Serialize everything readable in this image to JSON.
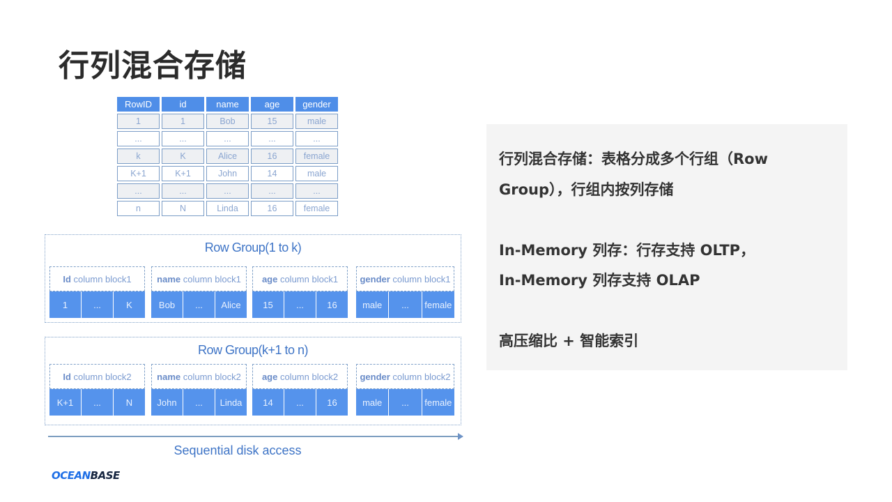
{
  "title": "行列混合存储",
  "source_table": {
    "headers": [
      "RowID",
      "id",
      "name",
      "age",
      "gender"
    ],
    "rows": [
      [
        "1",
        "1",
        "Bob",
        "15",
        "male"
      ],
      [
        "...",
        "...",
        "...",
        "...",
        "..."
      ],
      [
        "k",
        "K",
        "Alice",
        "16",
        "female"
      ],
      [
        "K+1",
        "K+1",
        "John",
        "14",
        "male"
      ],
      [
        "...",
        "...",
        "...",
        "...",
        "..."
      ],
      [
        "n",
        "N",
        "Linda",
        "16",
        "female"
      ]
    ]
  },
  "row_groups": [
    {
      "title": "Row Group(1 to k)",
      "blocks": [
        {
          "bold": "Id",
          "rest": " column  block1",
          "cells": [
            "1",
            "...",
            "K"
          ]
        },
        {
          "bold": "name",
          "rest": " column block1",
          "cells": [
            "Bob",
            "...",
            "Alice"
          ]
        },
        {
          "bold": "age",
          "rest": " column  block1",
          "cells": [
            "15",
            "...",
            "16"
          ]
        },
        {
          "bold": "gender",
          "rest": " column block1",
          "cells": [
            "male",
            "...",
            "female"
          ]
        }
      ]
    },
    {
      "title": "Row Group(k+1 to n)",
      "blocks": [
        {
          "bold": "Id",
          "rest": " column  block2",
          "cells": [
            "K+1",
            "...",
            "N"
          ]
        },
        {
          "bold": "name",
          "rest": " column block2",
          "cells": [
            "John",
            "...",
            "Linda"
          ]
        },
        {
          "bold": "age",
          "rest": " column  block2",
          "cells": [
            "14",
            "...",
            "16"
          ]
        },
        {
          "bold": "gender",
          "rest": " column block2",
          "cells": [
            "male",
            "...",
            "female"
          ]
        }
      ]
    }
  ],
  "arrow_label": "Sequential disk access",
  "logo": {
    "part1": "OCEAN",
    "part2": "BASE"
  },
  "panel": {
    "lines": [
      "行列混合存储：表格分成多个行组（Row",
      "Group），行组内按列存储",
      "In-Memory 列存：行存支持 OLTP，",
      "In-Memory 列存支持 OLAP",
      "高压缩比 + 智能索引"
    ]
  },
  "colors": {
    "accent": "#4f8ee8",
    "cell_blue": "#5593ec",
    "text_blue": "#3e74c6",
    "panel_bg": "#f4f4f4"
  }
}
